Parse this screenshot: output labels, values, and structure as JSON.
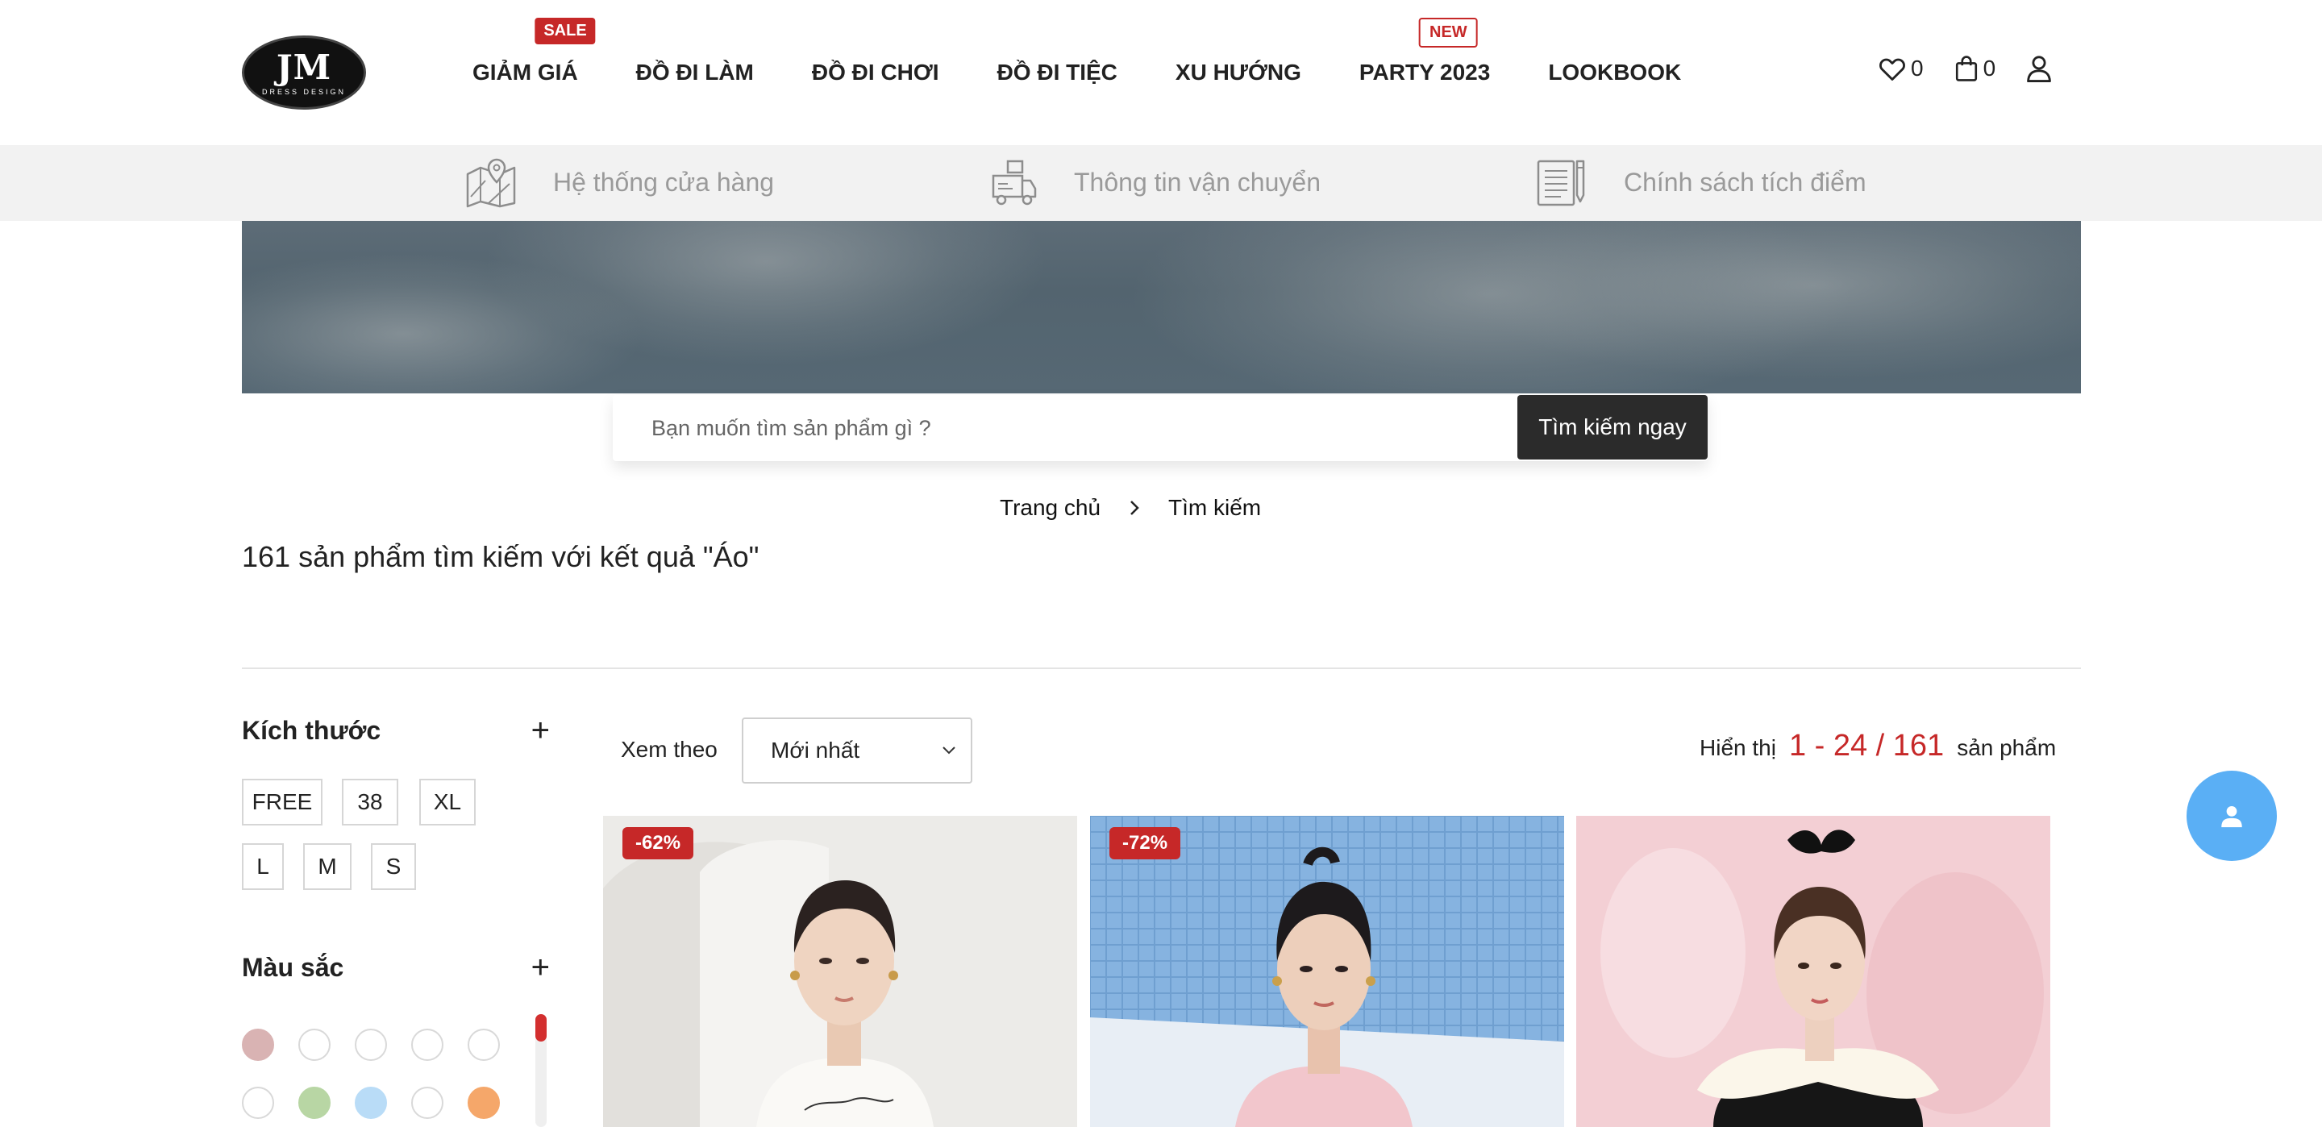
{
  "header": {
    "logo": {
      "mark": "JM",
      "sub": "DRESS DESIGN"
    },
    "nav": [
      {
        "label": "GIẢM GIÁ",
        "badge": "SALE"
      },
      {
        "label": "ĐỒ ĐI LÀM"
      },
      {
        "label": "ĐỒ ĐI CHƠI"
      },
      {
        "label": "ĐỒ ĐI TIỆC"
      },
      {
        "label": "XU HƯỚNG"
      },
      {
        "label": "PARTY 2023",
        "badge": "NEW"
      },
      {
        "label": "LOOKBOOK"
      }
    ],
    "wishlist_count": "0",
    "cart_count": "0",
    "icons": [
      "heart-icon",
      "bag-icon",
      "user-icon"
    ]
  },
  "infobar": [
    {
      "label": "Hệ thống cửa hàng",
      "icon": "map-pin-icon"
    },
    {
      "label": "Thông tin vận chuyển",
      "icon": "truck-icon"
    },
    {
      "label": "Chính sách tích điểm",
      "icon": "document-pen-icon"
    }
  ],
  "search": {
    "placeholder": "Bạn muốn tìm sản phẩm gì ?",
    "value": "",
    "button_label": "Tìm kiếm ngay"
  },
  "breadcrumb": {
    "home": "Trang chủ",
    "current": "Tìm kiếm"
  },
  "results": {
    "title": "161 sản phẩm tìm kiếm với kết quả \"Áo\""
  },
  "filters": {
    "size": {
      "title": "Kích thước",
      "toggle": "+",
      "options": [
        "FREE",
        "38",
        "XL",
        "L",
        "M",
        "S"
      ]
    },
    "color": {
      "title": "Màu sắc",
      "toggle": "+",
      "swatches": [
        "#d9b3b3",
        "#ffffff",
        "#ffffff",
        "#ffffff",
        "#ffffff",
        "#ffffff",
        "#b8d6a4",
        "#b9dcf7",
        "#ffffff",
        "#f5a76a"
      ]
    }
  },
  "toolbar": {
    "sort_label": "Xem theo",
    "sort_selected": "Mới nhất",
    "show_prefix": "Hiển thị",
    "show_range": "1 - 24 / 161",
    "show_suffix": "sản phẩm"
  },
  "products": [
    {
      "discount": "-62%"
    },
    {
      "discount": "-72%"
    },
    {
      "discount": ""
    }
  ],
  "colors": {
    "accent": "#c62828",
    "dark_button": "#2b2b2b",
    "chat": "#5aaff5",
    "infobar_bg": "#f2f2f2"
  }
}
